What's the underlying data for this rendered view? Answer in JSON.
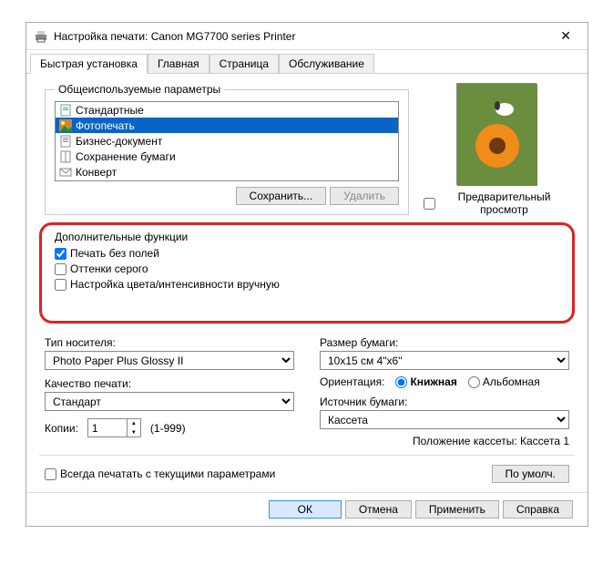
{
  "window": {
    "title": "Настройка печати: Canon MG7700 series Printer"
  },
  "tabs": {
    "items": [
      "Быстрая установка",
      "Главная",
      "Страница",
      "Обслуживание"
    ],
    "active": 0
  },
  "profiles": {
    "legend": "Общеиспользуемые параметры",
    "items": [
      {
        "label": "Стандартные",
        "selected": false
      },
      {
        "label": "Фотопечать",
        "selected": true
      },
      {
        "label": "Бизнес-документ",
        "selected": false
      },
      {
        "label": "Сохранение бумаги",
        "selected": false
      },
      {
        "label": "Конверт",
        "selected": false
      }
    ],
    "save_btn": "Сохранить...",
    "delete_btn": "Удалить"
  },
  "preview": {
    "checkbox_label": "Предварительный просмотр"
  },
  "features": {
    "legend": "Дополнительные функции",
    "items": [
      {
        "label": "Печать без полей",
        "checked": true
      },
      {
        "label": "Оттенки серого",
        "checked": false
      },
      {
        "label": "Настройка цвета/интенсивности вручную",
        "checked": false
      }
    ]
  },
  "media": {
    "label": "Тип носителя:",
    "value": "Photo Paper Plus Glossy II"
  },
  "quality": {
    "label": "Качество печати:",
    "value": "Стандарт"
  },
  "paper": {
    "label": "Размер бумаги:",
    "value": "10x15 см 4\"x6\""
  },
  "orientation": {
    "label": "Ориентация:",
    "portrait": "Книжная",
    "landscape": "Альбомная",
    "selected": "portrait"
  },
  "source": {
    "label": "Источник бумаги:",
    "value": "Кассета"
  },
  "cassette_status": {
    "label": "Положение кассеты:",
    "value": "Кассета 1"
  },
  "copies": {
    "label": "Копии:",
    "value": "1",
    "range": "(1-999)"
  },
  "always_print": {
    "label": "Всегда печатать с текущими параметрами"
  },
  "defaults_btn": "По умолч.",
  "footer": {
    "ok": "ОК",
    "cancel": "Отмена",
    "apply": "Применить",
    "help": "Справка"
  }
}
